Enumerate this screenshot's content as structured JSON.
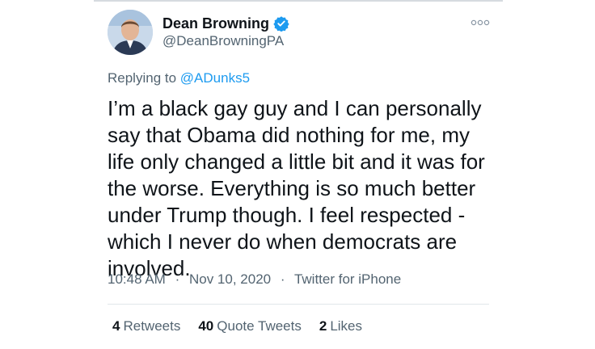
{
  "author": {
    "name": "Dean Browning",
    "handle": "@DeanBrowningPA",
    "verified": true
  },
  "reply": {
    "prefix": "Replying to",
    "target": "@ADunks5"
  },
  "tweet": {
    "text": "I’m a black gay guy and I can personally say that Obama did nothing for me, my life only changed a little bit and it was for the worse. Everything is so much better under Trump though. I feel respected - which I never do when democrats are involved."
  },
  "meta": {
    "time": "10:48 AM",
    "date": "Nov 10, 2020",
    "client": "Twitter for iPhone",
    "separator": "·"
  },
  "stats": {
    "retweets_count": "4",
    "retweets_label": "Retweets",
    "quotes_count": "40",
    "quotes_label": "Quote Tweets",
    "likes_count": "2",
    "likes_label": "Likes"
  },
  "colors": {
    "link": "#1d9bf0",
    "secondary_text": "#536471",
    "primary_text": "#0f1419",
    "verified_badge": "#1d9bf0"
  },
  "icons": {
    "verified": "verified-badge-icon",
    "more": "more-options-icon"
  }
}
